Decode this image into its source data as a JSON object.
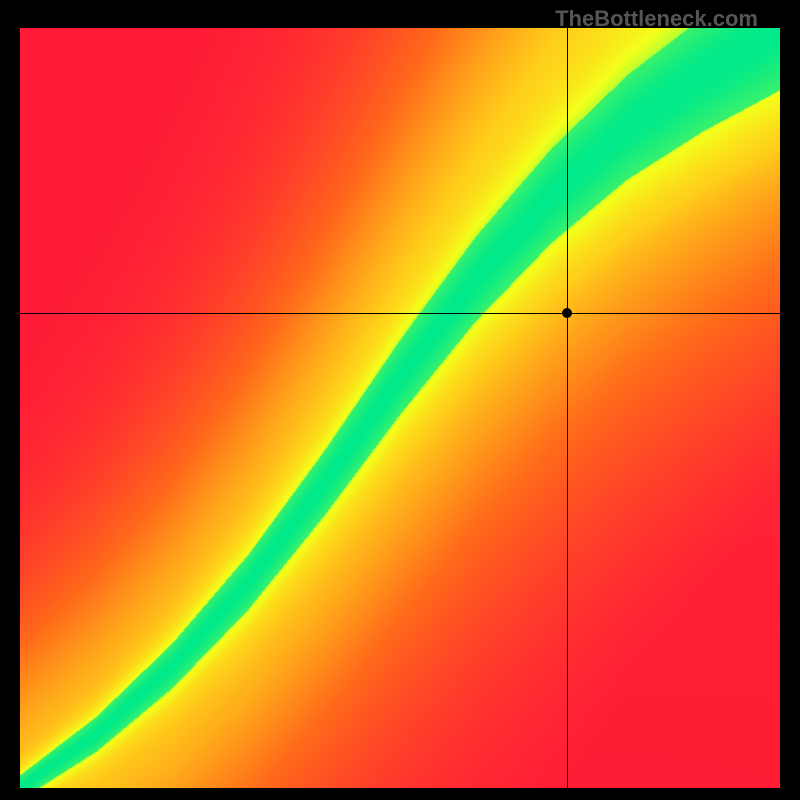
{
  "watermark": "TheBottleneck.com",
  "chart_data": {
    "type": "heatmap",
    "title": "",
    "xlabel": "",
    "ylabel": "",
    "xlim": [
      0,
      1
    ],
    "ylim": [
      0,
      1
    ],
    "grid": false,
    "legend": false,
    "crosshair": {
      "x": 0.72,
      "y": 0.625
    },
    "ridge": {
      "description": "Peak-value curve (green band centerline), y as fraction from bottom for given x fraction",
      "points": [
        {
          "x": 0.0,
          "y": 0.0
        },
        {
          "x": 0.1,
          "y": 0.07
        },
        {
          "x": 0.2,
          "y": 0.16
        },
        {
          "x": 0.3,
          "y": 0.27
        },
        {
          "x": 0.4,
          "y": 0.4
        },
        {
          "x": 0.5,
          "y": 0.54
        },
        {
          "x": 0.6,
          "y": 0.67
        },
        {
          "x": 0.7,
          "y": 0.78
        },
        {
          "x": 0.8,
          "y": 0.87
        },
        {
          "x": 0.9,
          "y": 0.94
        },
        {
          "x": 1.0,
          "y": 1.0
        }
      ]
    },
    "colorscale": [
      {
        "stop": 0.0,
        "color": "#ff1838"
      },
      {
        "stop": 0.3,
        "color": "#ff6a1a"
      },
      {
        "stop": 0.55,
        "color": "#ffcf1a"
      },
      {
        "stop": 0.75,
        "color": "#f4ff1a"
      },
      {
        "stop": 0.88,
        "color": "#9bff3a"
      },
      {
        "stop": 1.0,
        "color": "#00e98a"
      }
    ],
    "annotations": []
  }
}
